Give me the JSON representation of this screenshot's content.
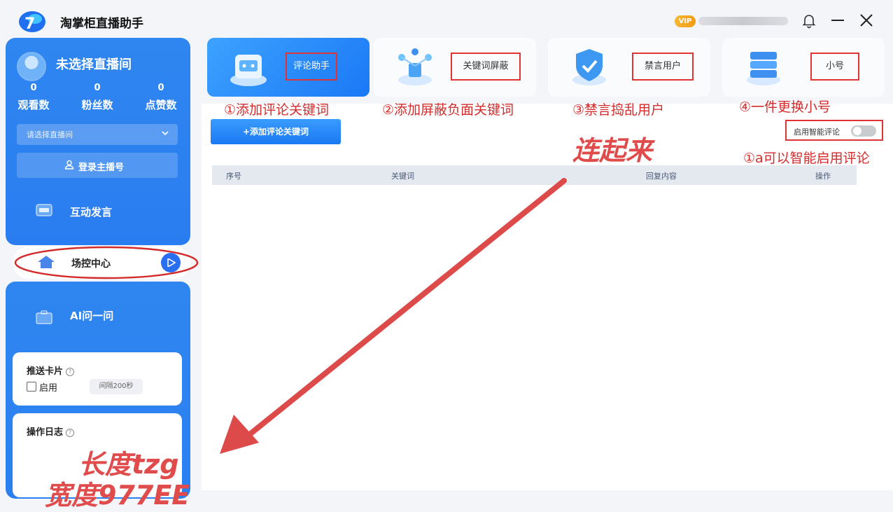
{
  "app": {
    "title": "淘掌柜直播助手",
    "vip_badge": "VIP"
  },
  "sidebar": {
    "room_name": "未选择直播间",
    "stats": [
      {
        "value": "0",
        "label": "观看数"
      },
      {
        "value": "0",
        "label": "粉丝数"
      },
      {
        "value": "0",
        "label": "点赞数"
      }
    ],
    "room_select_placeholder": "请选择直播间",
    "login_button": "登录主播号",
    "nav": {
      "interaction": "互动发言",
      "control_center": "场控中心",
      "ai_ask": "AI问一问"
    },
    "push_card": {
      "title": "推送卡片",
      "enable_label": "启用",
      "interval": "间隔200秒",
      "enabled": false
    },
    "log_card": {
      "title": "操作日志"
    }
  },
  "tabs": [
    {
      "label": "评论助手",
      "icon": "comment-robot-icon",
      "active": true
    },
    {
      "label": "关键词屏蔽",
      "icon": "keyword-network-icon",
      "active": false
    },
    {
      "label": "禁言用户",
      "icon": "shield-check-icon",
      "active": false
    },
    {
      "label": "小号",
      "icon": "server-stack-icon",
      "active": false
    }
  ],
  "annotations": {
    "step1": "①添加评论关键词",
    "step2": "②添加屏蔽负面关键词",
    "step3": "③禁言捣乱用户",
    "step4": "④一件更换小号",
    "step1a": "①a可以智能启用评论",
    "connect": "连起来",
    "watermark1": "长度tzg",
    "watermark2": "宽度977EE"
  },
  "comment_panel": {
    "add_button": "+添加评论关键词",
    "smart_toggle_label": "启用智能评论",
    "smart_enabled": false,
    "table_headers": [
      "序号",
      "关键词",
      "回复内容",
      "操作"
    ]
  },
  "colors": {
    "accent_blue": "#2a7df0",
    "annotation_red": "#d42c2c"
  }
}
